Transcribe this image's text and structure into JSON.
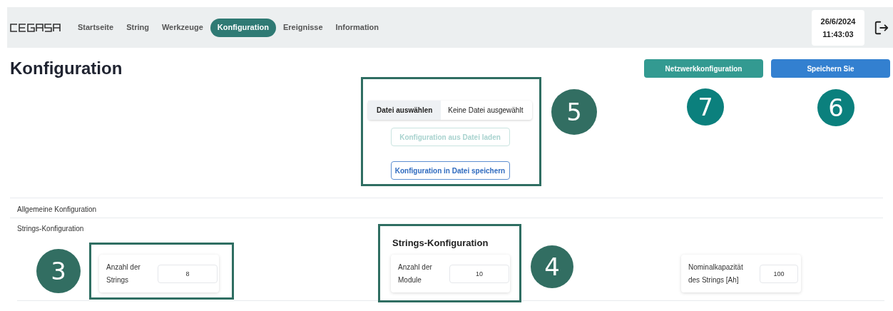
{
  "nav": {
    "items": [
      {
        "label": "Startseite",
        "selected": false
      },
      {
        "label": "String",
        "selected": false
      },
      {
        "label": "Werkzeuge",
        "selected": false
      },
      {
        "label": "Konfiguration",
        "selected": true
      },
      {
        "label": "Ereignisse",
        "selected": false
      },
      {
        "label": "Information",
        "selected": false
      }
    ],
    "date": "26/6/2024",
    "time": "11:43:03"
  },
  "page": {
    "title": "Konfiguration",
    "buttons": [
      {
        "label": "Netzwerkkonfiguration",
        "kind": "secondary"
      },
      {
        "label": "Speichern Sie",
        "kind": "primary"
      }
    ]
  },
  "file": {
    "choose_label": "Datei auswählen",
    "status": "Keine Datei ausgewählt",
    "load_button": {
      "label": "Konfiguration aus Datei laden",
      "disabled": true
    },
    "save_button": {
      "label": "Konfiguration in Datei speichern",
      "disabled": false
    }
  },
  "sections": [
    {
      "label": "Allgemeine Konfiguration"
    },
    {
      "label": "Strings-Konfiguration"
    }
  ],
  "strings": {
    "title": "Strings-Konfiguration",
    "fields": [
      {
        "label": "Anzahl der Strings",
        "value": "8"
      },
      {
        "label": "Anzahl der Module",
        "value": "10"
      },
      {
        "label": "Nominalkapazität des Strings [Ah]",
        "value": "100"
      }
    ]
  },
  "annotations": [
    "5",
    "7",
    "6",
    "3",
    "4"
  ]
}
